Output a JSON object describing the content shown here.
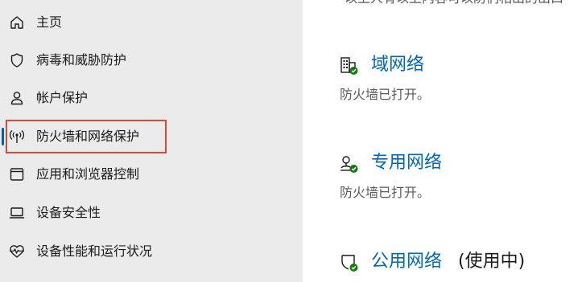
{
  "sidebar": {
    "items": [
      {
        "label": "主页",
        "icon": "home-icon"
      },
      {
        "label": "病毒和威胁防护",
        "icon": "shield-icon"
      },
      {
        "label": "帐户保护",
        "icon": "person-icon"
      },
      {
        "label": "防火墙和网络保护",
        "icon": "antenna-icon",
        "selected": true
      },
      {
        "label": "应用和浏览器控制",
        "icon": "app-window-icon"
      },
      {
        "label": "设备安全性",
        "icon": "laptop-icon"
      },
      {
        "label": "设备性能和运行状况",
        "icon": "heart-pulse-icon"
      }
    ]
  },
  "main": {
    "top_cut_text": "以上人有以上内容可以防们相出的出口",
    "networks": [
      {
        "title": "域网络",
        "status": "防火墙已打开。",
        "icon": "domain-network-icon"
      },
      {
        "title": "专用网络",
        "status": "防火墙已打开。",
        "icon": "private-network-icon"
      },
      {
        "title": "公用网络",
        "suffix": "(使用中)",
        "icon": "public-network-icon"
      }
    ]
  },
  "colors": {
    "sidebar_bg": "#ebebeb",
    "accent": "#005fb8",
    "link": "#0067c0",
    "highlight_border": "#d84a34",
    "status_ok": "#0f7b0f"
  }
}
